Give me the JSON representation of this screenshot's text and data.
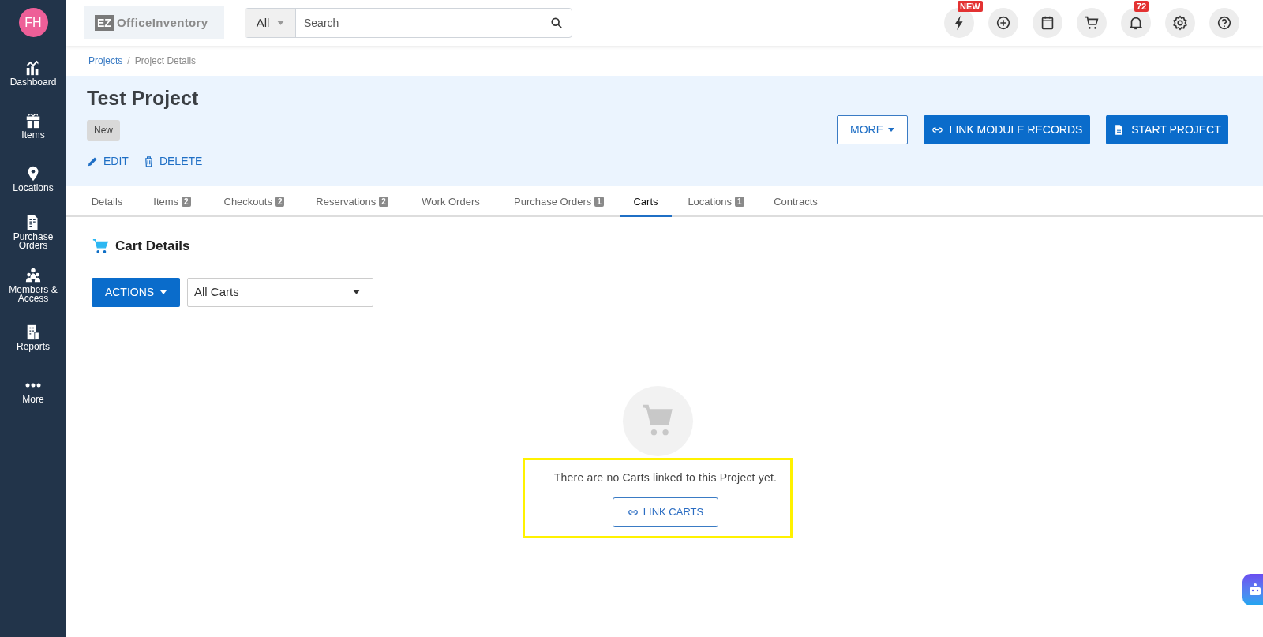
{
  "user": {
    "initials": "FH"
  },
  "sidebar": {
    "items": [
      {
        "label": "Dashboard",
        "kind": "dashboard"
      },
      {
        "label": "Items",
        "kind": "items"
      },
      {
        "label": "Locations",
        "kind": "locations"
      },
      {
        "label": "Purchase Orders",
        "kind": "purchase"
      },
      {
        "label": "Members & Access",
        "kind": "members"
      },
      {
        "label": "Reports",
        "kind": "reports"
      },
      {
        "label": "More",
        "kind": "more"
      }
    ]
  },
  "logo": {
    "mark": "EZ",
    "name": "OfficeInventory"
  },
  "search": {
    "scope": "All",
    "placeholder": "Search"
  },
  "toolbar": [
    {
      "kind": "bolt",
      "badge": "NEW"
    },
    {
      "kind": "plus"
    },
    {
      "kind": "calendar"
    },
    {
      "kind": "cart"
    },
    {
      "kind": "bell",
      "badge": "72"
    },
    {
      "kind": "gear"
    },
    {
      "kind": "help"
    }
  ],
  "breadcrumb": {
    "items": [
      "Projects",
      "Project Details"
    ],
    "separator": "/"
  },
  "project": {
    "title": "Test Project",
    "status": "New",
    "actions": [
      "EDIT",
      "DELETE"
    ],
    "buttons": [
      {
        "label": "MORE",
        "kind": "dropdown"
      },
      {
        "label": "LINK MODULE RECORDS",
        "kind": "link"
      },
      {
        "label": "START PROJECT",
        "kind": "doc"
      }
    ]
  },
  "tabs": [
    {
      "label": "Details",
      "selected": false
    },
    {
      "label": "Items",
      "count": "2",
      "selected": false
    },
    {
      "label": "Checkouts",
      "count": "2",
      "selected": false
    },
    {
      "label": "Reservations",
      "count": "2",
      "selected": false
    },
    {
      "label": "Work Orders",
      "selected": false
    },
    {
      "label": "Purchase Orders",
      "count": "1",
      "selected": false
    },
    {
      "label": "Carts",
      "selected": true
    },
    {
      "label": "Locations",
      "count": "1",
      "selected": false
    },
    {
      "label": "Contracts",
      "selected": false
    }
  ],
  "section": {
    "title": "Cart Details",
    "actions_button": "ACTIONS",
    "filter": "All Carts"
  },
  "empty_state": {
    "message": "There are no Carts linked to this Project yet.",
    "button": "LINK CARTS"
  }
}
